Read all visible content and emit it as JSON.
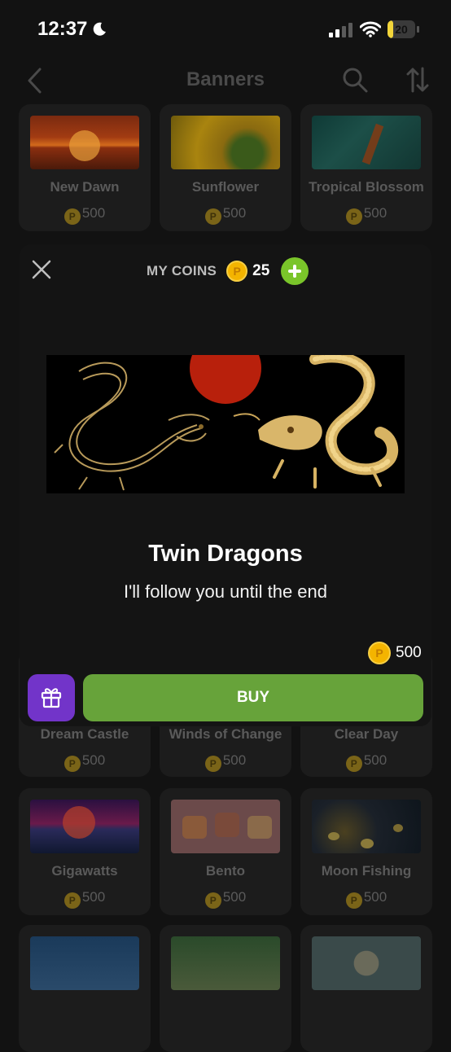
{
  "status_bar": {
    "time": "12:37",
    "battery": "20",
    "battery_level": 0.2
  },
  "nav": {
    "title": "Banners"
  },
  "colors": {
    "coin": "#f4b400",
    "buy": "#67a33a",
    "gift": "#7234c9",
    "add": "#7ac52a"
  },
  "cards": [
    {
      "name": "New Dawn",
      "price": "500"
    },
    {
      "name": "Sunflower",
      "price": "500"
    },
    {
      "name": "Tropical Blossom",
      "price": "500"
    },
    {
      "name": "Dream Castle",
      "price": "500"
    },
    {
      "name": "Winds of Change",
      "price": "500"
    },
    {
      "name": "Clear Day",
      "price": "500"
    },
    {
      "name": "Gigawatts",
      "price": "500"
    },
    {
      "name": "Bento",
      "price": "500"
    },
    {
      "name": "Moon Fishing",
      "price": "500"
    }
  ],
  "modal": {
    "coins_label": "MY COINS",
    "coins_value": "25",
    "coin_symbol": "P",
    "title": "Twin Dragons",
    "subtitle": "I'll follow you until the end",
    "price": "500",
    "buy_label": "BUY"
  },
  "icons": [
    "moon-icon",
    "cellular-signal-icon",
    "wifi-icon",
    "battery-icon",
    "back-chevron-icon",
    "search-icon",
    "sort-icon",
    "close-icon",
    "coin-icon",
    "plus-icon",
    "gift-icon"
  ]
}
